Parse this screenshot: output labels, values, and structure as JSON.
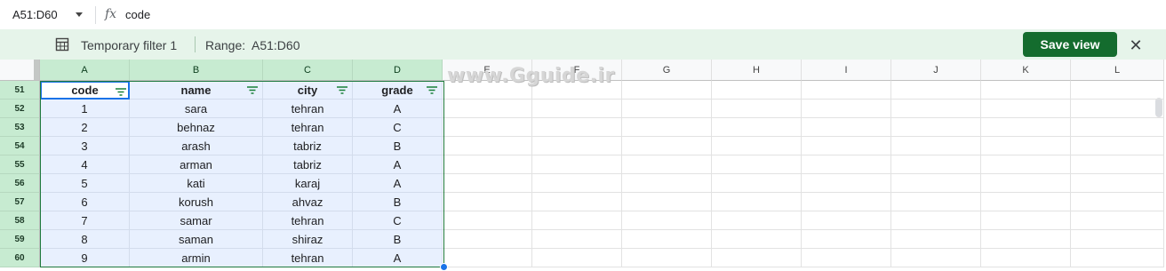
{
  "formula_bar": {
    "name_box": "A51:D60",
    "fx_label": "fx",
    "content": "code"
  },
  "filter_bar": {
    "filter_name": "Temporary filter 1",
    "range_label": "Range:",
    "range_value": "A51:D60",
    "save_label": "Save view",
    "close_label": "✕"
  },
  "watermark": "www.Gguide.ir",
  "columns": [
    "A",
    "B",
    "C",
    "D",
    "E",
    "F",
    "G",
    "H",
    "I",
    "J",
    "K",
    "L"
  ],
  "rows": [
    "51",
    "52",
    "53",
    "54",
    "55",
    "56",
    "57",
    "58",
    "59",
    "60"
  ],
  "table": {
    "headers": [
      "code",
      "name",
      "city",
      "grade"
    ],
    "rows": [
      [
        "1",
        "sara",
        "tehran",
        "A"
      ],
      [
        "2",
        "behnaz",
        "tehran",
        "C"
      ],
      [
        "3",
        "arash",
        "tabriz",
        "B"
      ],
      [
        "4",
        "arman",
        "tabriz",
        "A"
      ],
      [
        "5",
        "kati",
        "karaj",
        "A"
      ],
      [
        "6",
        "korush",
        "ahvaz",
        "B"
      ],
      [
        "7",
        "samar",
        "tehran",
        "C"
      ],
      [
        "8",
        "saman",
        "shiraz",
        "B"
      ],
      [
        "9",
        "armin",
        "tehran",
        "A"
      ]
    ]
  },
  "colors": {
    "save_button": "#146c2e",
    "filter_bar": "#e6f4ea",
    "selection_fill": "#e8f0fe",
    "selected_header": "#c7ebd1"
  }
}
